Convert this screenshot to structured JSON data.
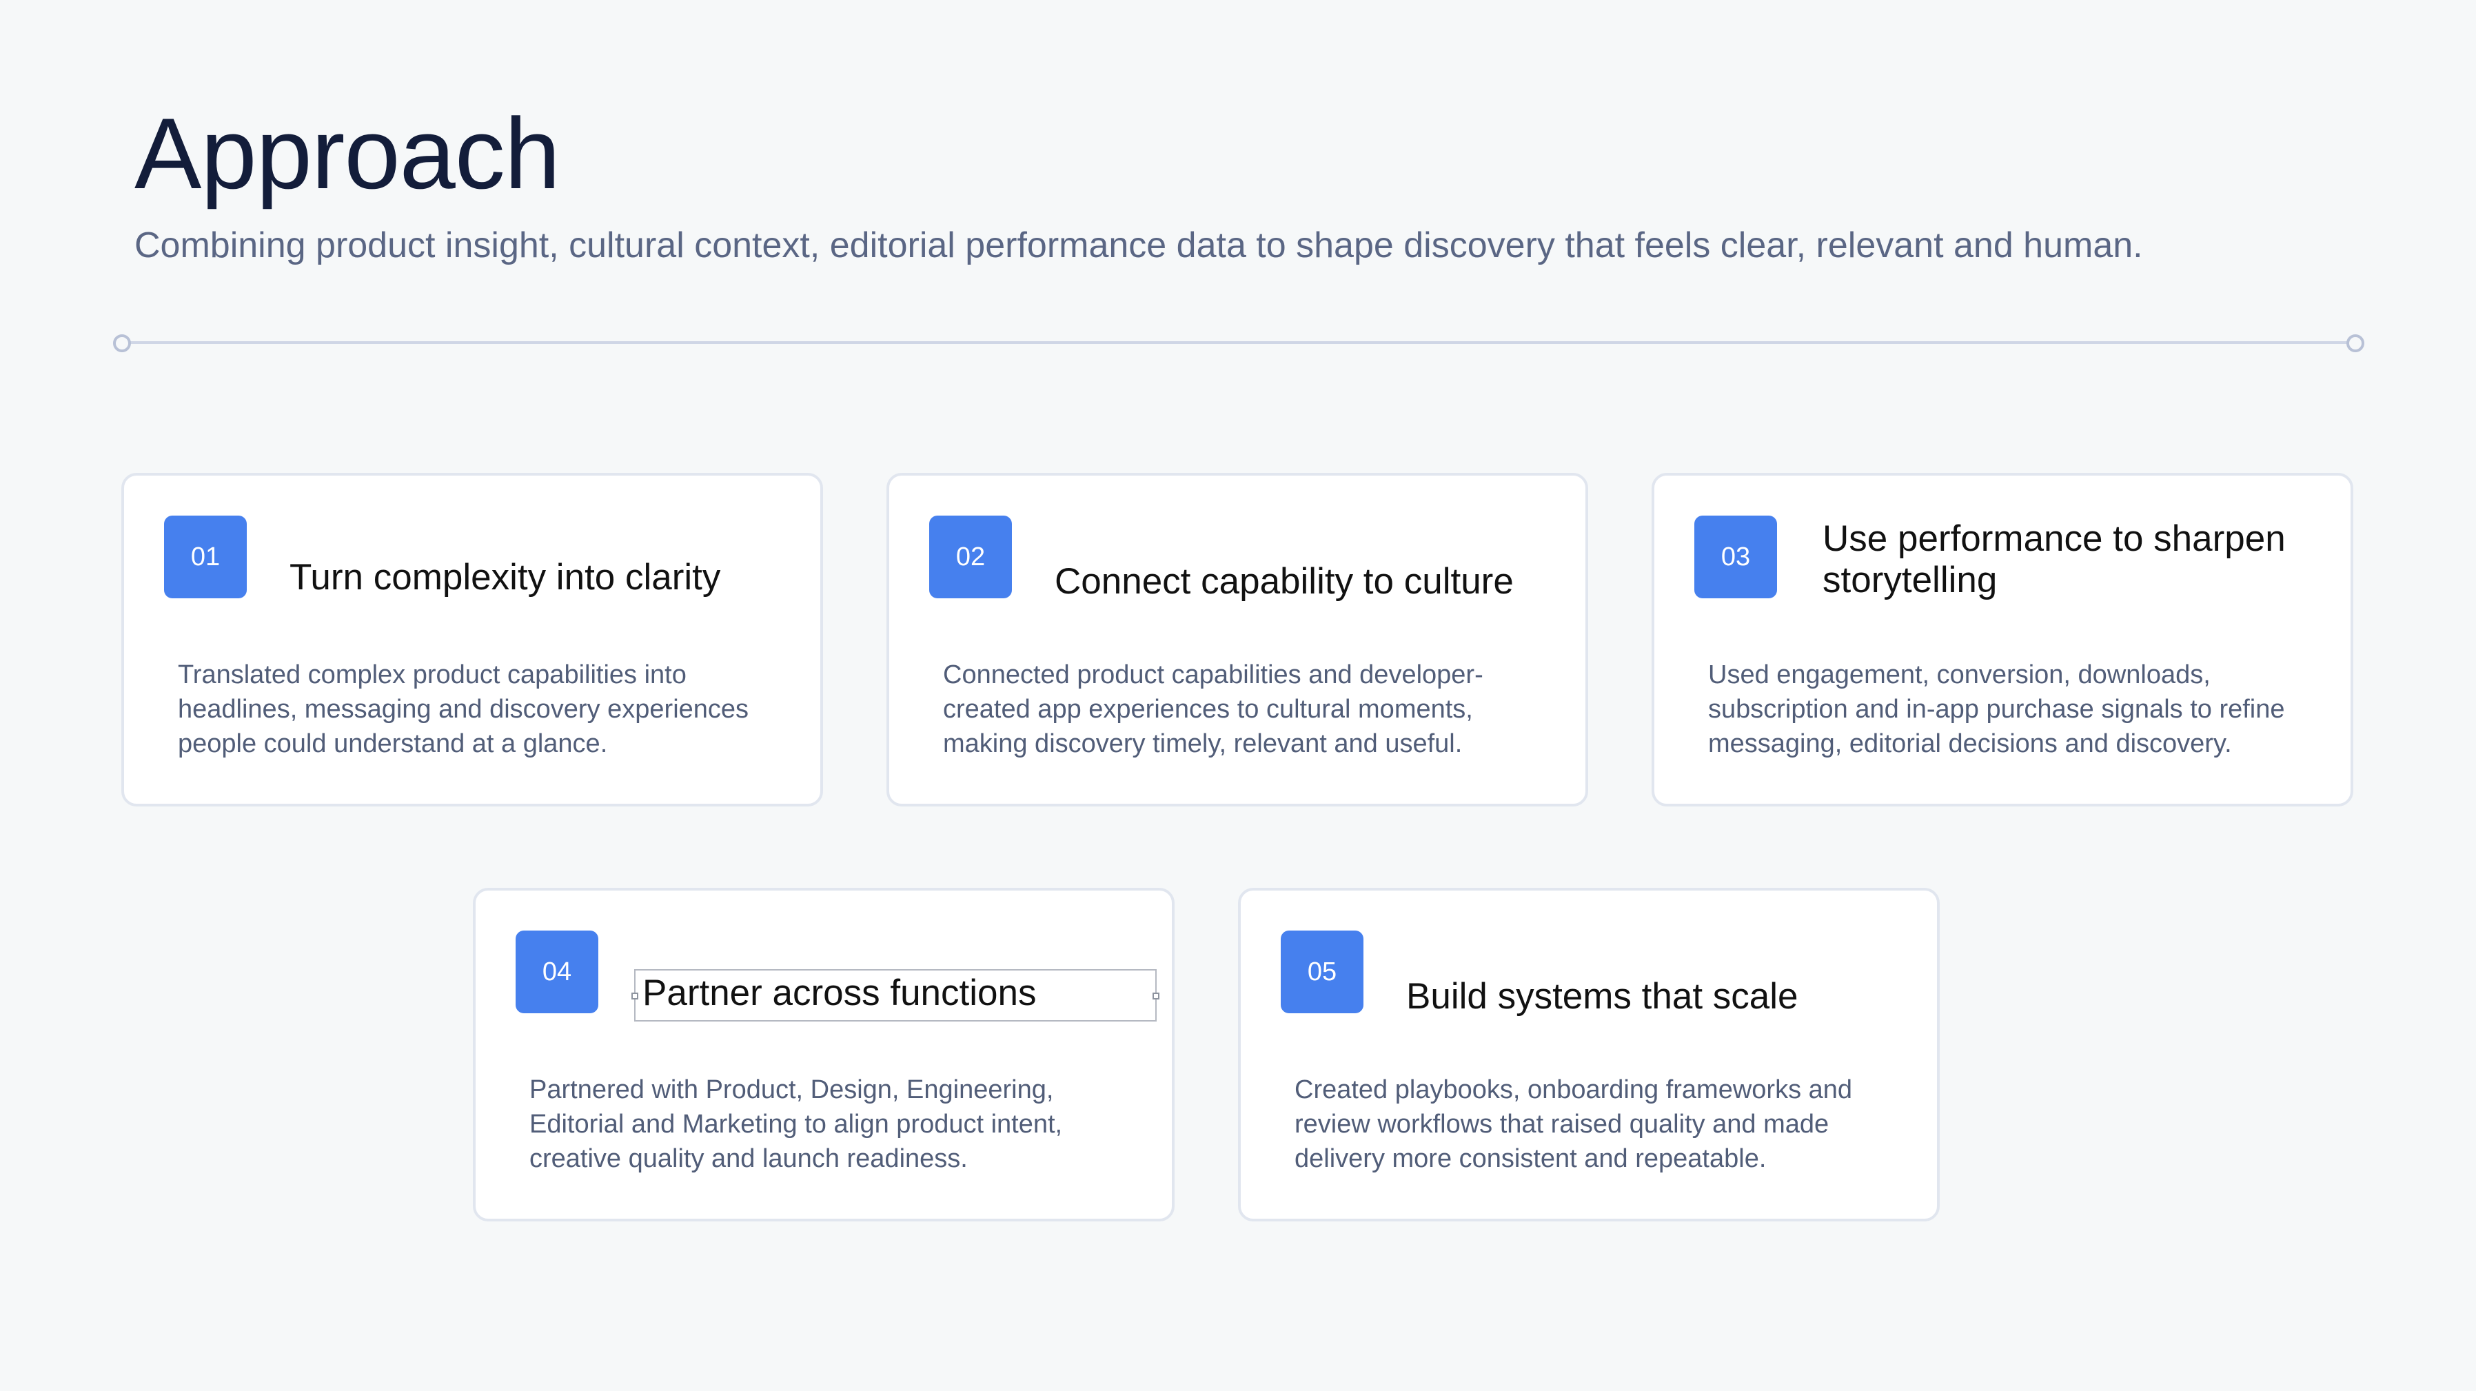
{
  "slide": {
    "title": "Approach",
    "subtitle": "Combining product insight, cultural context, editorial performance data to shape discovery that feels clear, relevant and human."
  },
  "cards": [
    {
      "number": "01",
      "title": "Turn complexity into clarity",
      "body": "Translated complex product capabilities into headlines, messaging and discovery experiences people could understand at a glance."
    },
    {
      "number": "02",
      "title": "Connect capability to culture",
      "body": "Connected product capabilities and developer-created app experiences to cultural moments, making discovery timely, relevant and useful."
    },
    {
      "number": "03",
      "title": "Use performance to sharpen storytelling",
      "body": "Used engagement, conversion, downloads, subscription and in-app purchase signals to refine messaging, editorial decisions and discovery."
    },
    {
      "number": "04",
      "title": "Partner across functions",
      "body": "Partnered with Product, Design, Engineering, Editorial and Marketing to align product intent, creative quality and launch readiness."
    },
    {
      "number": "05",
      "title": "Build systems that scale",
      "body": "Created playbooks, onboarding frameworks and review workflows that raised quality and made delivery more consistent and repeatable."
    }
  ],
  "colors": {
    "background": "#f6f8f9",
    "title_text": "#131d3a",
    "accent_badge": "#4680ee",
    "divider": "#cfd6e6",
    "card_border": "#e1e6ef"
  }
}
